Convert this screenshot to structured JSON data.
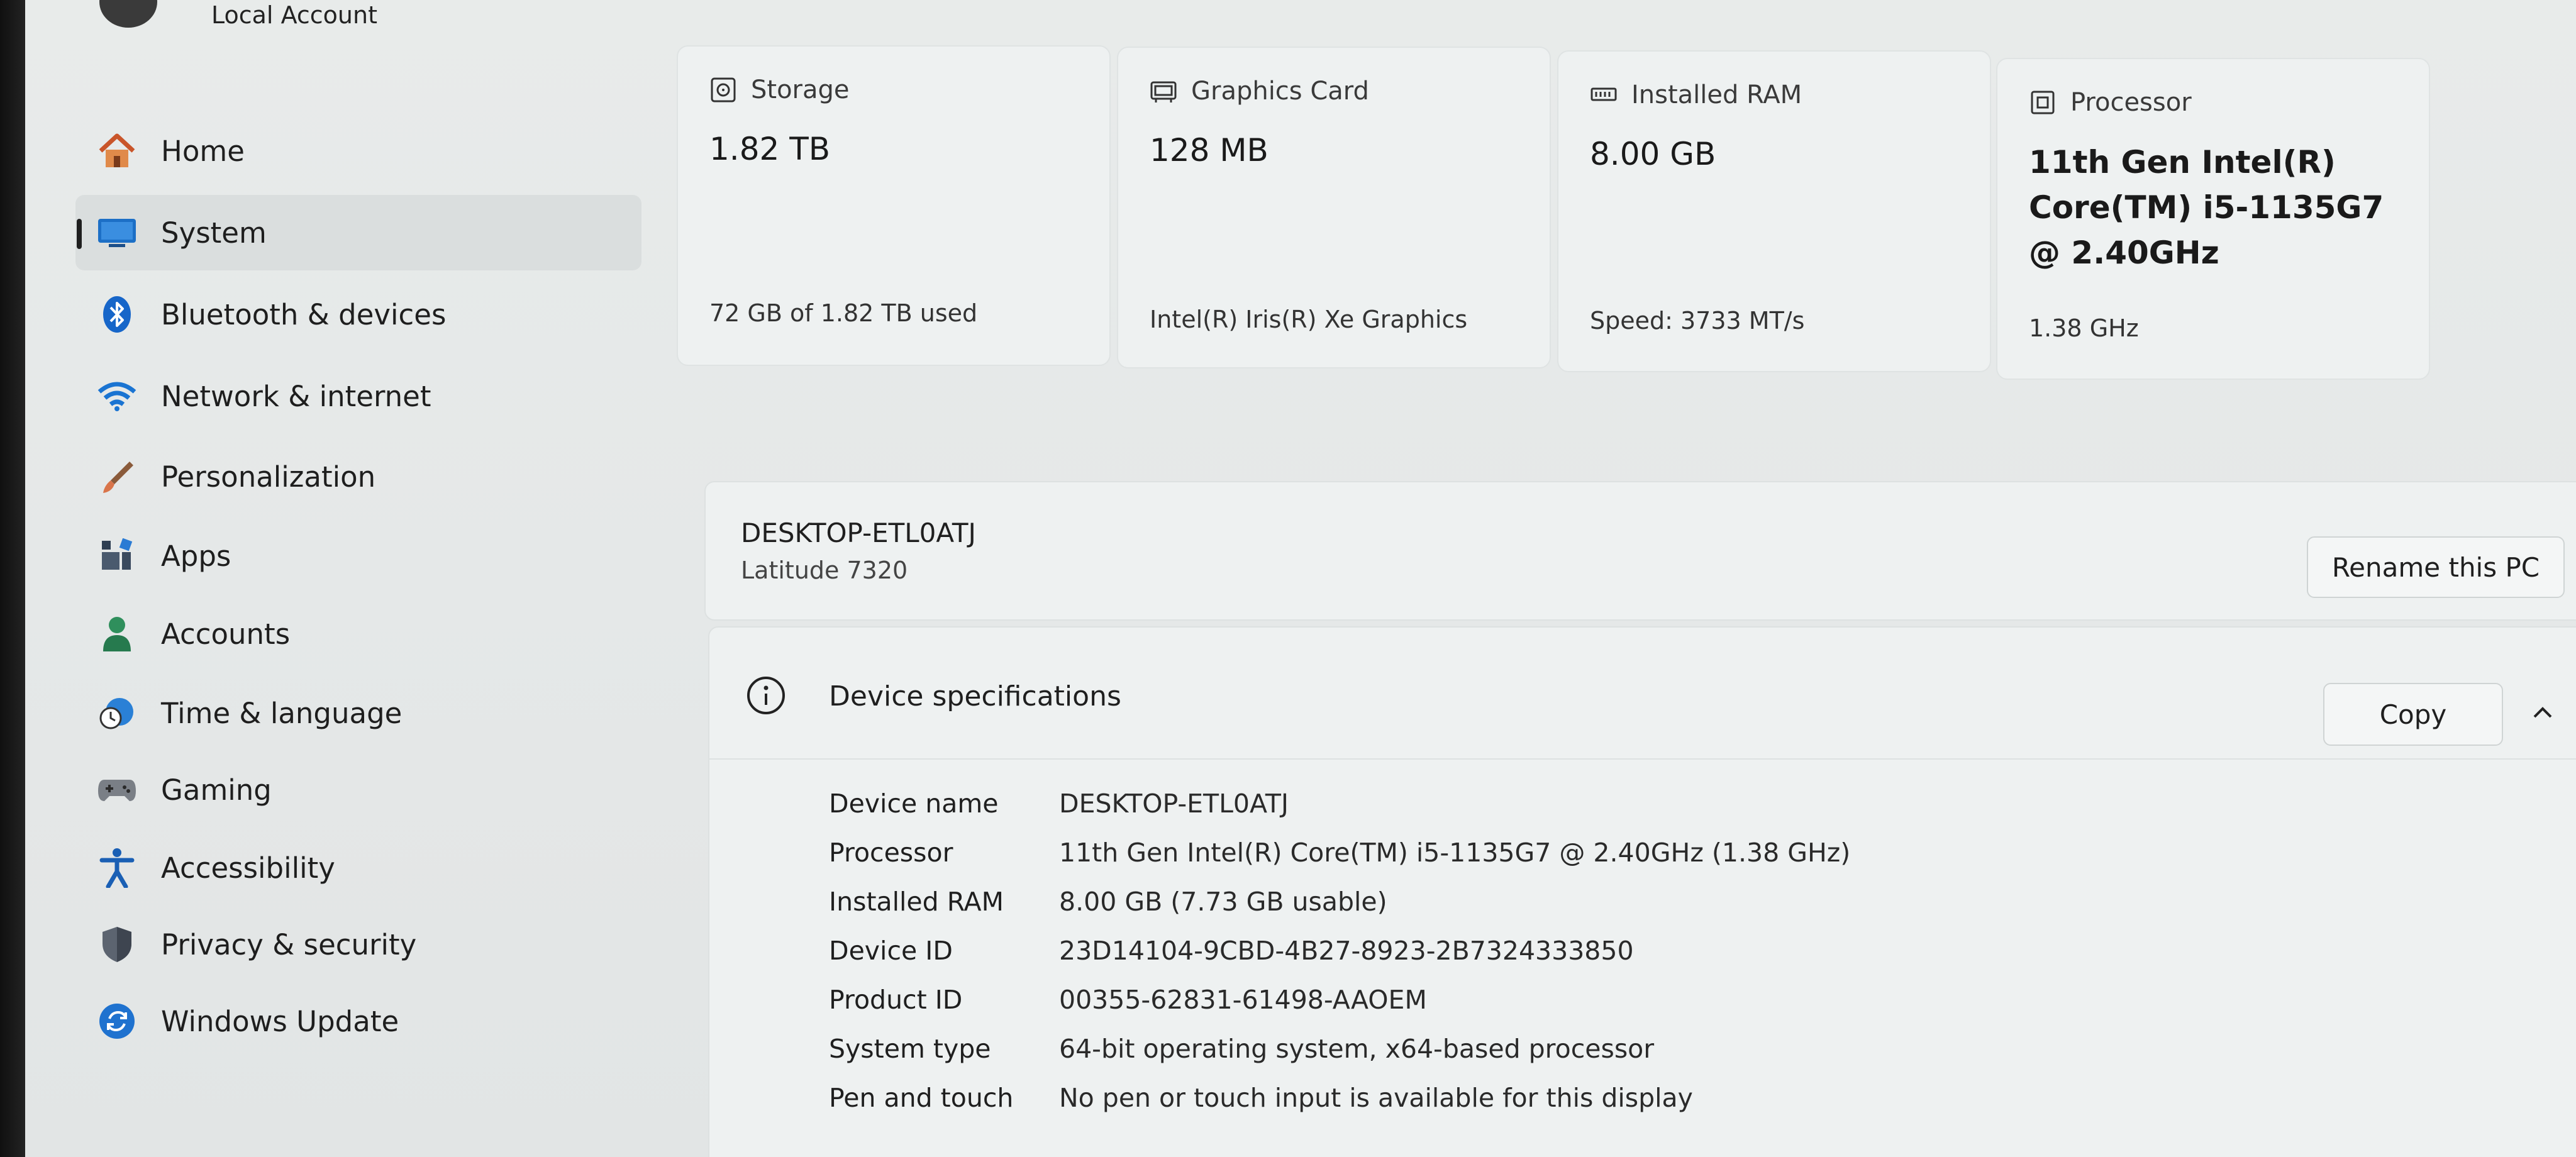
{
  "account": {
    "label": "Local Account"
  },
  "nav": {
    "items": [
      {
        "label": "Home",
        "icon": "home-icon"
      },
      {
        "label": "System",
        "icon": "system-icon",
        "active": true
      },
      {
        "label": "Bluetooth & devices",
        "icon": "bluetooth-icon"
      },
      {
        "label": "Network & internet",
        "icon": "wifi-icon"
      },
      {
        "label": "Personalization",
        "icon": "brush-icon"
      },
      {
        "label": "Apps",
        "icon": "apps-icon"
      },
      {
        "label": "Accounts",
        "icon": "person-icon"
      },
      {
        "label": "Time & language",
        "icon": "clock-globe-icon"
      },
      {
        "label": "Gaming",
        "icon": "gamepad-icon"
      },
      {
        "label": "Accessibility",
        "icon": "accessibility-icon"
      },
      {
        "label": "Privacy & security",
        "icon": "shield-icon"
      },
      {
        "label": "Windows Update",
        "icon": "update-icon"
      }
    ]
  },
  "cards": {
    "storage": {
      "title": "Storage",
      "value": "1.82 TB",
      "sub": "72 GB of 1.82 TB used",
      "icon": "storage-icon"
    },
    "graphics": {
      "title": "Graphics Card",
      "value": "128 MB",
      "sub": "Intel(R) Iris(R) Xe Graphics",
      "icon": "graphics-card-icon"
    },
    "ram": {
      "title": "Installed RAM",
      "value": "8.00 GB",
      "sub": "Speed: 3733 MT/s",
      "icon": "ram-icon"
    },
    "processor": {
      "title": "Processor",
      "value": "11th Gen Intel(R) Core(TM) i5-1135G7 @ 2.40GHz",
      "sub": "1.38 GHz",
      "icon": "processor-icon"
    }
  },
  "pc": {
    "name": "DESKTOP-ETL0ATJ",
    "model": "Latitude 7320",
    "rename_label": "Rename this PC"
  },
  "specs": {
    "title": "Device specifications",
    "copy_label": "Copy",
    "rows": [
      {
        "key": "Device name",
        "value": "DESKTOP-ETL0ATJ"
      },
      {
        "key": "Processor",
        "value": "11th Gen Intel(R) Core(TM) i5-1135G7 @ 2.40GHz (1.38 GHz)"
      },
      {
        "key": "Installed RAM",
        "value": "8.00 GB (7.73 GB usable)"
      },
      {
        "key": "Device ID",
        "value": "23D14104-9CBD-4B27-8923-2B7324333850"
      },
      {
        "key": "Product ID",
        "value": "00355-62831-61498-AAOEM"
      },
      {
        "key": "System type",
        "value": "64-bit operating system, x64-based processor"
      },
      {
        "key": "Pen and touch",
        "value": "No pen or touch input is available for this display"
      }
    ]
  },
  "colors": {
    "accent": "#0067c0",
    "background": "#e8ebea",
    "card": "#eef1f1"
  }
}
